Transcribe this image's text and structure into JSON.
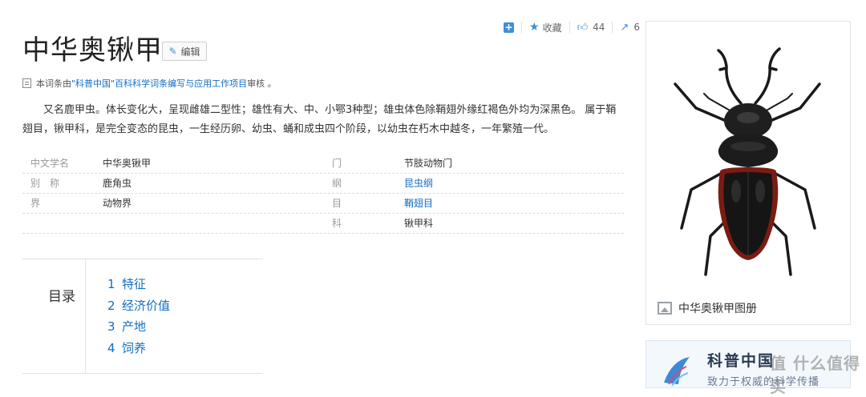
{
  "toolbar": {
    "collect_label": "收藏",
    "like_count": "44",
    "share_count": "6"
  },
  "title": "中华奥锹甲",
  "edit_label": "编辑",
  "source": {
    "prefix": "本词条由",
    "link": "\"科普中国\"百科科学词条编写与应用工作项目",
    "suffix": " 审核 。"
  },
  "summary": "又名鹿甲虫。体长变化大，呈现雌雄二型性；雄性有大、中、小鄂3种型；雄虫体色除鞘翅外缘红褐色外均为深黑色。 属于鞘翅目，锹甲科，是完全变态的昆虫，一生经历卵、幼虫、蛹和成虫四个阶段，以幼虫在朽木中越冬，一年繁殖一代。",
  "basic_info": [
    {
      "k1": "中文学名",
      "v1": "中华奥锹甲",
      "k2": "门",
      "v2": "节肢动物门"
    },
    {
      "k1": "别　称",
      "v1": "鹿角虫",
      "k2": "纲",
      "v2": "昆虫纲"
    },
    {
      "k1": "界",
      "v1": "动物界",
      "k2": "目",
      "v2": "鞘翅目"
    },
    {
      "k1": "",
      "v1": "",
      "k2": "科",
      "v2": "锹甲科"
    }
  ],
  "toc": {
    "label": "目录",
    "items": [
      {
        "num": "1",
        "text": "特征"
      },
      {
        "num": "2",
        "text": "经济价值"
      },
      {
        "num": "3",
        "text": "产地"
      },
      {
        "num": "4",
        "text": "饲养"
      }
    ]
  },
  "album": {
    "caption": "中华奥锹甲图册"
  },
  "banner": {
    "title": "科普中国",
    "subtitle": "致力于权威的科学传播"
  },
  "watermark": "值 什么值得买"
}
